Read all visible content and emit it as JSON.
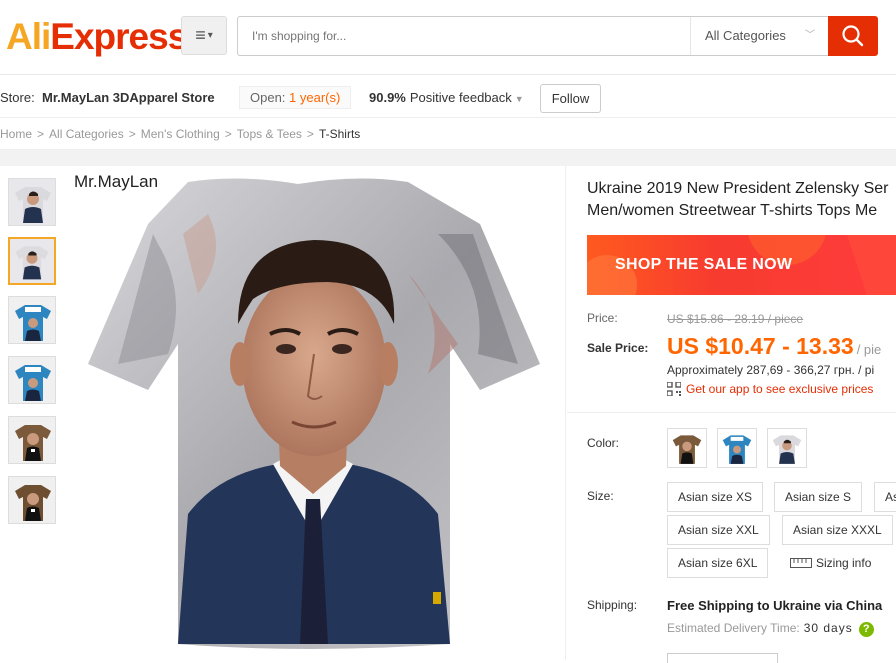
{
  "header": {
    "logo_part1": "Ali",
    "logo_part2": "Express",
    "search_placeholder": "I'm shopping for...",
    "category_select": "All Categories"
  },
  "store": {
    "label": "Store:",
    "name": "Mr.MayLan 3DApparel Store",
    "open_label": "Open:",
    "open_years": "1 year(s)",
    "feedback_pct": "90.9%",
    "feedback_label": "Positive feedback",
    "follow_label": "Follow"
  },
  "breadcrumb": [
    "Home",
    "All Categories",
    "Men's Clothing",
    "Tops & Tees",
    "T-Shirts"
  ],
  "gallery": {
    "watermark": "Mr.MayLan",
    "thumb_count": 6,
    "selected_thumb": 2
  },
  "product": {
    "title_line1": "Ukraine 2019 New President Zelensky Ser",
    "title_line2": "Men/women Streetwear T-shirts Tops Me",
    "banner": "SHOP THE SALE NOW",
    "price_label": "Price:",
    "old_price": "US $15.86 - 28.19 / piece",
    "sale_label": "Sale Price:",
    "sale_price": "US $10.47 - 13.33",
    "sale_unit": "/ pie",
    "approx": "Approximately 287,69 - 366,27 грн. / pi",
    "app_link": "Get our app to see exclusive prices",
    "color_label": "Color:",
    "size_label": "Size:",
    "sizes": [
      "Asian size XS",
      "Asian size S",
      "As",
      "Asian size XXL",
      "Asian size XXXL",
      "Asian size 6XL"
    ],
    "sizing_info": "Sizing info",
    "shipping_label": "Shipping:",
    "shipping_text": "Free Shipping to Ukraine via China",
    "est_label": "Estimated Delivery Time:",
    "est_value": "30 days"
  },
  "colors": {
    "accent": "#e62e04",
    "orange": "#ff6600",
    "logo_orange": "#f5a623"
  }
}
